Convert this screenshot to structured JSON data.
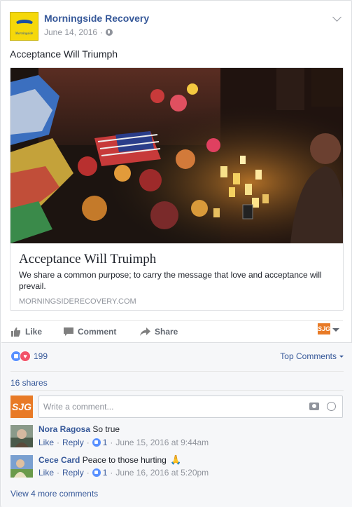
{
  "post": {
    "page_name": "Morningside Recovery",
    "logo_text": "Morningside",
    "date": "June 14, 2016",
    "separator": "·",
    "text": "Acceptance Will Triumph"
  },
  "link_preview": {
    "title": "Acceptance Will Truimph",
    "description": "We share a common purpose; to carry the message that love and acceptance will prevail.",
    "domain": "MORNINGSIDERECOVERY.COM"
  },
  "actions": {
    "like": "Like",
    "comment": "Comment",
    "share": "Share",
    "profile_badge": "SJG"
  },
  "feedback": {
    "reaction_count": "199",
    "sort_label": "Top Comments",
    "shares": "16 shares",
    "composer_avatar": "SJG",
    "composer_placeholder": "Write a comment...",
    "view_more": "View 4 more comments"
  },
  "comments": [
    {
      "author": "Nora Ragosa",
      "text": "So true",
      "like": "Like",
      "reply": "Reply",
      "likes": "1",
      "timestamp": "June 15, 2016 at 9:44am"
    },
    {
      "author": "Cece Card",
      "text": "Peace to those hurting",
      "like": "Like",
      "reply": "Reply",
      "likes": "1",
      "timestamp": "June 16, 2016 at 5:20pm"
    }
  ],
  "colors": {
    "link_blue": "#365899",
    "meta_gray": "#90949c",
    "like_blue": "#5890ff",
    "love_red": "#f25268",
    "sjg_orange": "#e87a26",
    "logo_yellow": "#f5d80a"
  }
}
